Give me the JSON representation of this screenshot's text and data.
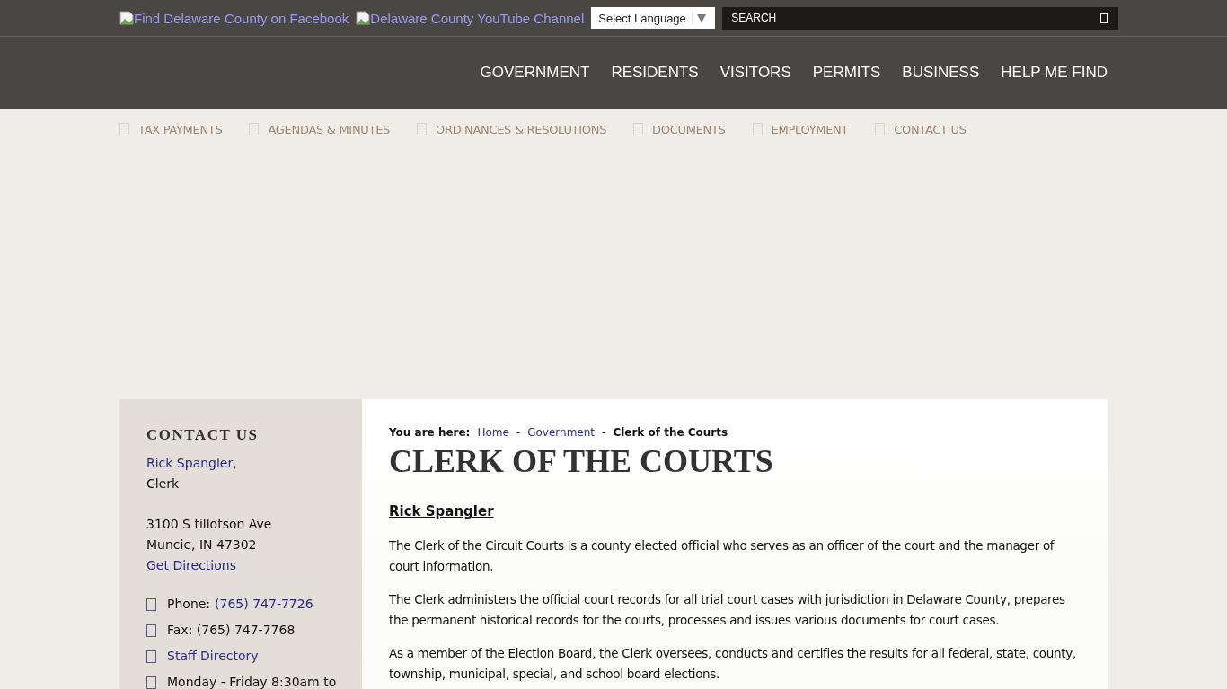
{
  "top_bar": {
    "social_links": [
      "Find Delaware County on Facebook",
      "Delaware County YouTube Channel"
    ],
    "language_select": {
      "value": "Select Language"
    },
    "search": {
      "placeholder": "SEARCH"
    }
  },
  "main_nav": [
    "GOVERNMENT",
    "RESIDENTS",
    "VISITORS",
    "PERMITS",
    "BUSINESS",
    "HELP ME FIND"
  ],
  "quick_links": [
    "TAX PAYMENTS",
    "AGENDAS & MINUTES",
    "ORDINANCES & RESOLUTIONS",
    "DOCUMENTS",
    "EMPLOYMENT",
    "CONTACT US"
  ],
  "sidebar": {
    "title": "CONTACT US",
    "name_link": "Rick Spangler",
    "name_suffix": ",",
    "role": "Clerk",
    "address": [
      "3100 S tillotson Ave",
      "Muncie, IN 47302"
    ],
    "directions_link": "Get Directions",
    "items": [
      {
        "label": "Phone:",
        "link": "(765) 747-7726"
      },
      {
        "label": "Fax: (765) 747-7768"
      },
      {
        "link": "Staff Directory"
      },
      {
        "label": "Monday - Friday 8:30am to"
      }
    ]
  },
  "breadcrumb": {
    "prefix": "You are here:",
    "links": [
      "Home",
      "Government"
    ],
    "separators": [
      "-",
      "-"
    ],
    "current": "Clerk of the Courts"
  },
  "page_title": "CLERK OF THE COURTS",
  "subheading": "Rick Spangler",
  "paragraphs": [
    "The Clerk of the Circuit Courts is a county elected official who serves as an officer of the court and the manager of court information.",
    "The Clerk administers the official court records for all trial court cases with jurisdiction in Delaware County, prepares the permanent historical records for the courts, processes and issues various documents for court cases.",
    "As a member of the Election Board, the Clerk oversees, conducts and certifies the results for all federal, state, county, township, municipal, special, and school board elections."
  ]
}
